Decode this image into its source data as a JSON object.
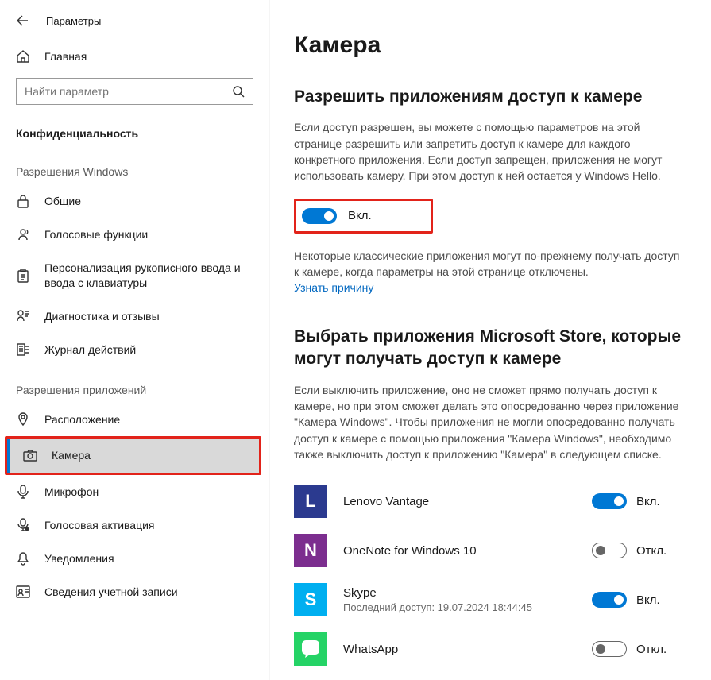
{
  "titlebar": {
    "title": "Параметры"
  },
  "sidebar": {
    "home": "Главная",
    "search_placeholder": "Найти параметр",
    "privacy_label": "Конфиденциальность",
    "group_windows": "Разрешения Windows",
    "group_apps": "Разрешения приложений",
    "items_windows": [
      {
        "label": "Общие"
      },
      {
        "label": "Голосовые функции"
      },
      {
        "label": "Персонализация рукописного ввода и ввода с клавиатуры"
      },
      {
        "label": "Диагностика и отзывы"
      },
      {
        "label": "Журнал действий"
      }
    ],
    "items_apps": [
      {
        "label": "Расположение"
      },
      {
        "label": "Камера"
      },
      {
        "label": "Микрофон"
      },
      {
        "label": "Голосовая активация"
      },
      {
        "label": "Уведомления"
      },
      {
        "label": "Сведения учетной записи"
      }
    ]
  },
  "main": {
    "title": "Камера",
    "allow": {
      "heading": "Разрешить приложениям доступ к камере",
      "desc": "Если доступ разрешен, вы можете с помощью параметров на этой странице разрешить или запретить доступ к камере для каждого конкретного приложения. Если доступ запрещен, приложения не могут использовать камеру. При этом доступ к ней остается у Windows Hello.",
      "state": "Вкл.",
      "note": "Некоторые классические приложения могут по-прежнему получать доступ к камере, когда параметры на этой странице отключены.",
      "learn": "Узнать причину"
    },
    "choose": {
      "heading": "Выбрать приложения Microsoft Store, которые могут получать доступ к камере",
      "desc": "Если выключить приложение, оно не сможет прямо получать доступ к камере, но при этом сможет делать это опосредованно через приложение \"Камера Windows\". Чтобы приложения не могли опосредованно получать доступ к камере с помощью приложения \"Камера Windows\", необходимо также выключить доступ к приложению \"Камера\" в следующем списке."
    },
    "apps": [
      {
        "name": "Lenovo Vantage",
        "sub": "",
        "state": "Вкл.",
        "on": true,
        "letter": "L",
        "bg": "#2b3a8f"
      },
      {
        "name": "OneNote for Windows 10",
        "sub": "",
        "state": "Откл.",
        "on": false,
        "letter": "N",
        "bg": "#7c2e8f"
      },
      {
        "name": "Skype",
        "sub": "Последний доступ: 19.07.2024 18:44:45",
        "state": "Вкл.",
        "on": true,
        "letter": "S",
        "bg": "#00aff0"
      },
      {
        "name": "WhatsApp",
        "sub": "",
        "state": "Откл.",
        "on": false,
        "letter": "",
        "bg": "#25d366"
      }
    ]
  }
}
